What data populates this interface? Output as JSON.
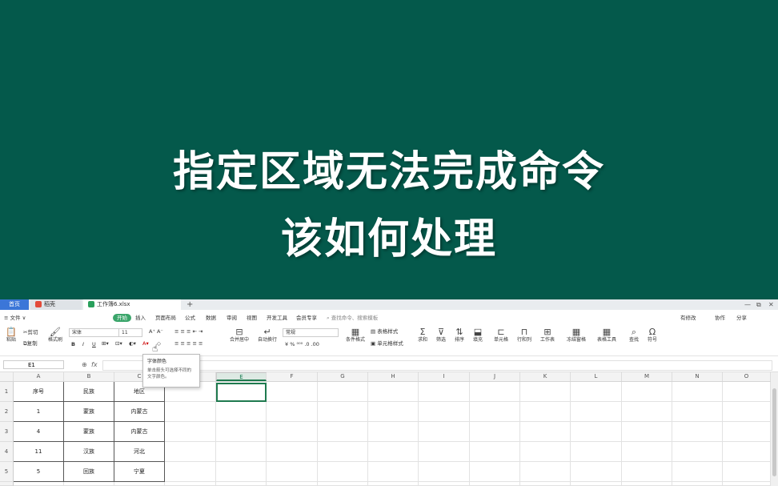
{
  "banner": {
    "line1": "指定区域无法完成命令",
    "line2": "该如何处理"
  },
  "tabs": [
    {
      "label": "首页"
    },
    {
      "label": "稻壳"
    },
    {
      "label": "工作簿6.xlsx"
    }
  ],
  "add_tab": "+",
  "window_controls": [
    "—",
    "⧉",
    "✕"
  ],
  "menu": {
    "file": "≡ 文件 ∨",
    "items": [
      "开始",
      "插入",
      "页面布局",
      "公式",
      "数据",
      "审阅",
      "视图",
      "开发工具",
      "会员专享"
    ],
    "search": "⌕ 查找命令、搜索模板",
    "right": [
      "有修改",
      "协作",
      "分享"
    ]
  },
  "ribbon": {
    "paste": "粘贴",
    "cut": "剪切",
    "copy": "复制",
    "format_painter": "格式刷",
    "font": "宋体",
    "size": "11",
    "bold": "B",
    "italic": "I",
    "underline": "U",
    "merge": "合并居中",
    "wrap": "自动换行",
    "number_format": "常规",
    "cond_format": "条件格式",
    "table_style": "表格样式",
    "cell_style": "单元格样式",
    "sum": "求和",
    "filter": "筛选",
    "sort": "排序",
    "fill": "填充",
    "cells": "单元格",
    "rowcol": "行和列",
    "sheet": "工作表",
    "freeze": "冻结窗格",
    "tools": "表格工具",
    "find": "查找",
    "symbol": "符号"
  },
  "tooltip": {
    "title": "字体颜色",
    "body": "单击箭头可选择不同的文字颜色。"
  },
  "formula_bar": {
    "cell_ref": "E1",
    "fx": "fx",
    "zoom_icon": "⊕"
  },
  "columns": [
    "A",
    "B",
    "C",
    "D",
    "E",
    "F",
    "G",
    "H",
    "I",
    "J",
    "K",
    "L",
    "M",
    "N",
    "O"
  ],
  "rows": [
    {
      "num": "1",
      "A": "序号",
      "B": "民族",
      "C": "地区"
    },
    {
      "num": "2",
      "A": "1",
      "B": "蒙族",
      "C": "内蒙古"
    },
    {
      "num": "3",
      "A": "4",
      "B": "蒙族",
      "C": "内蒙古"
    },
    {
      "num": "4",
      "A": "11",
      "B": "汉族",
      "C": "河北"
    },
    {
      "num": "5",
      "A": "5",
      "B": "回族",
      "C": "宁夏"
    }
  ],
  "colors": {
    "banner": "#04594b",
    "accent": "#3aa56a",
    "tab_home": "#3b76d8"
  }
}
